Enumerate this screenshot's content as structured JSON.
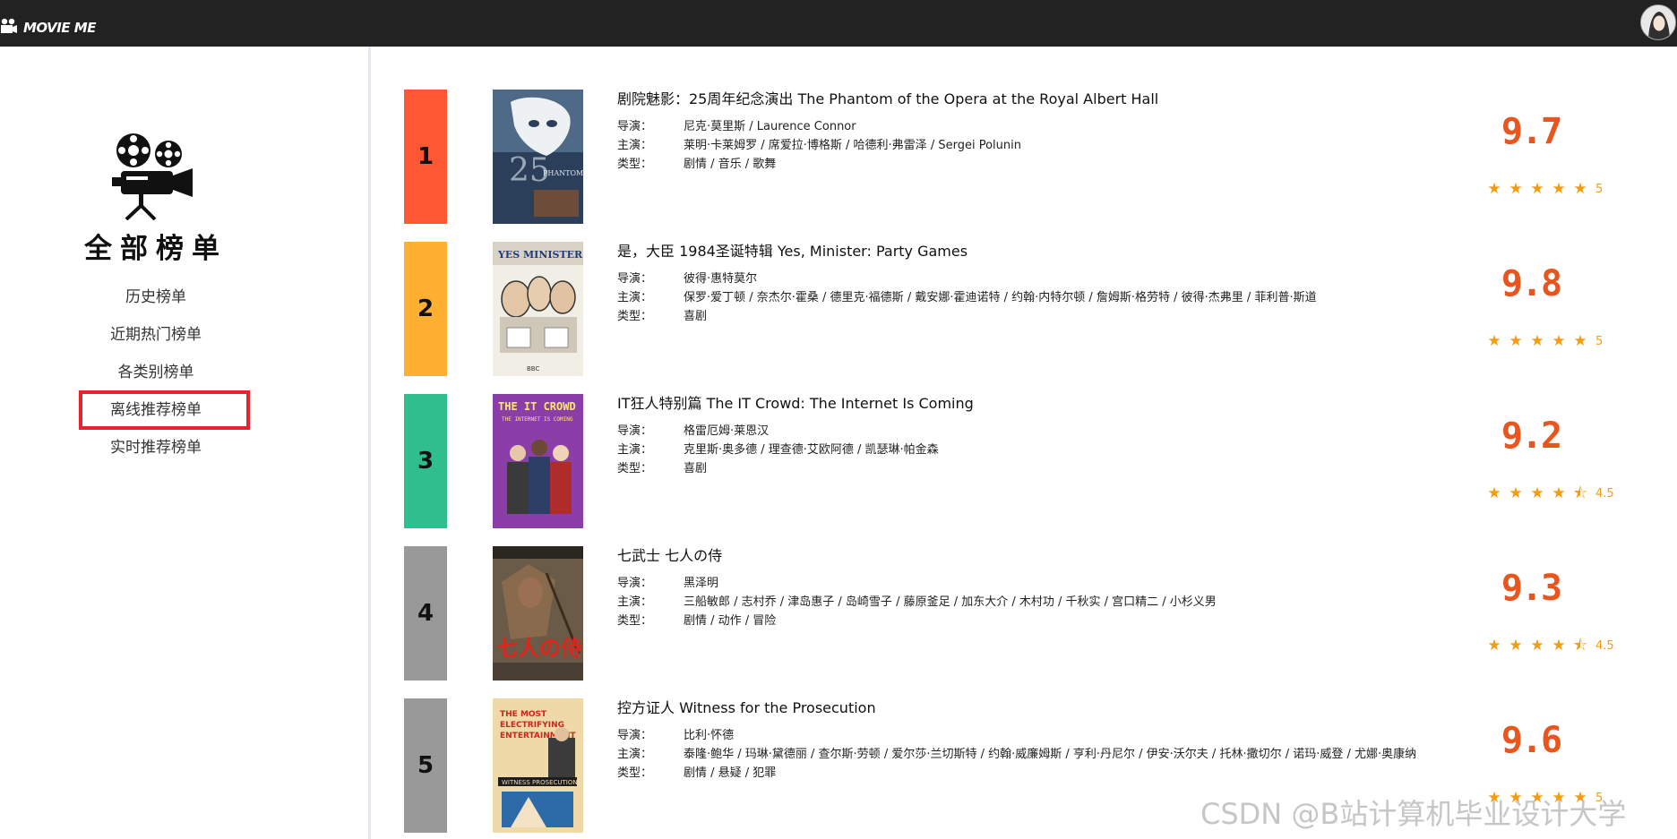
{
  "header": {
    "brand_name": "MOVIE ME",
    "brand_icon": "movie-camera-icon",
    "avatar": "user-avatar"
  },
  "sidebar": {
    "title": "全部榜单",
    "logo_icon": "film-projector-icon",
    "items": [
      {
        "label": "历史榜单"
      },
      {
        "label": "近期热门榜单"
      },
      {
        "label": "各类别榜单"
      },
      {
        "label": "离线推荐榜单",
        "highlighted": true
      },
      {
        "label": "实时推荐榜单"
      }
    ]
  },
  "labels": {
    "director": "导演：",
    "cast": "主演：",
    "genre": "类型："
  },
  "movies": [
    {
      "rank": "1",
      "rank_color": "#ff5733",
      "title": "剧院魅影：25周年纪念演出 The Phantom of the Opera at the Royal Albert Hall",
      "director": "尼克·莫里斯 / Laurence Connor",
      "cast": "莱明·卡莱姆罗 / 席爱拉·博格斯 / 哈德利·弗雷泽 / Sergei Polunin",
      "genre": "剧情 / 音乐 / 歌舞",
      "score": "9.7",
      "stars": 5,
      "rating": "5"
    },
    {
      "rank": "2",
      "rank_color": "#ffb031",
      "title": "是，大臣 1984圣诞特辑 Yes, Minister: Party Games",
      "director": "彼得·惠特莫尔",
      "cast": "保罗·爱丁顿 / 奈杰尔·霍桑 / 德里克·福德斯 / 戴安娜·霍迪诺特 / 约翰·内特尔顿 / 詹姆斯·格劳特 / 彼得·杰弗里 / 菲利普·斯道",
      "genre": "喜剧",
      "score": "9.8",
      "stars": 5,
      "rating": "5"
    },
    {
      "rank": "3",
      "rank_color": "#2fbf8f",
      "title": "IT狂人特别篇 The IT Crowd: The Internet Is Coming",
      "director": "格雷厄姆·莱恩汉",
      "cast": "克里斯·奥多德 / 理查德·艾欧阿德 / 凯瑟琳·帕金森",
      "genre": "喜剧",
      "score": "9.2",
      "stars": 4.5,
      "rating": "4.5"
    },
    {
      "rank": "4",
      "rank_color": "#999999",
      "title": "七武士 七人の侍",
      "director": "黑泽明",
      "cast": "三船敏郎 / 志村乔 / 津岛惠子 / 岛崎雪子 / 藤原釜足 / 加东大介 / 木村功 / 千秋实 / 宫口精二 / 小杉义男",
      "genre": "剧情 / 动作 / 冒险",
      "score": "9.3",
      "stars": 4.5,
      "rating": "4.5"
    },
    {
      "rank": "5",
      "rank_color": "#999999",
      "title": "控方证人 Witness for the Prosecution",
      "director": "比利·怀德",
      "cast": "泰隆·鲍华 / 玛琳·黛德丽 / 查尔斯·劳顿 / 爱尔莎·兰切斯特 / 约翰·威廉姆斯 / 亨利·丹尼尔 / 伊安·沃尔夫 / 托林·撒切尔 / 诺玛·威登 / 尤娜·奥康纳",
      "genre": "剧情 / 悬疑 / 犯罪",
      "score": "9.6",
      "stars": 5,
      "rating": "5"
    }
  ],
  "watermark": "CSDN @B站计算机毕业设计大学"
}
